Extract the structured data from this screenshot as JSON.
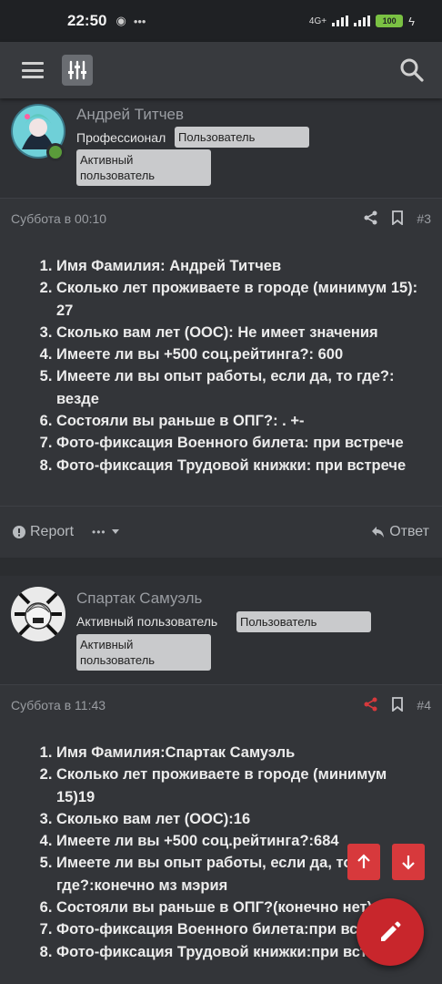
{
  "status_bar": {
    "time": "22:50",
    "battery": "100",
    "network": "4G+"
  },
  "posts": [
    {
      "author": "Андрей Титчев",
      "user_title": "Профессионал",
      "badge_primary": "Пользователь",
      "badge_secondary_line1": "Активный",
      "badge_secondary_line2": "пользователь",
      "date": "Суббота в 00:10",
      "number": "#3",
      "items": [
        "Имя Фамилия: Андрей Титчев",
        "Сколько лет проживаете в городе (минимум 15): 27",
        "Сколько вам лет (ООС): Не имеет значения",
        "Имеете ли вы +500 соц.рейтинга?: 600",
        "Имеете ли вы опыт работы, если да, то где?: везде",
        "Состояли вы раньше в ОПГ?: . +-",
        "Фото-фиксация Военного билета: при встрече",
        "Фото-фиксация Трудовой книжки: при встрече"
      ],
      "report_label": "Report",
      "more_label": "•••",
      "reply_label": "Ответ"
    },
    {
      "author": "Спартак Самуэль",
      "user_title": "Активный пользователь",
      "badge_primary": "Пользователь",
      "badge_secondary_line1": "Активный",
      "badge_secondary_line2": "пользователь",
      "date": "Суббота в 11:43",
      "number": "#4",
      "items": [
        "Имя Фамилия:Спартак Самуэль",
        "Сколько лет проживаете в городе (минимум 15)19",
        "Сколько вам лет (ООС):16",
        "Имеете ли вы +500 соц.рейтинга?:684",
        "Имеете ли вы опыт работы, если да, то где?:конечно мз мэрия",
        "Состояли вы раньше в ОПГ?(конечно нет)",
        "Фото-фиксация Военного билета:при вст",
        "Фото-фиксация Трудовой книжки:при вст"
      ]
    }
  ],
  "colors": {
    "accent": "#d7393c",
    "fab": "#c8262c"
  }
}
